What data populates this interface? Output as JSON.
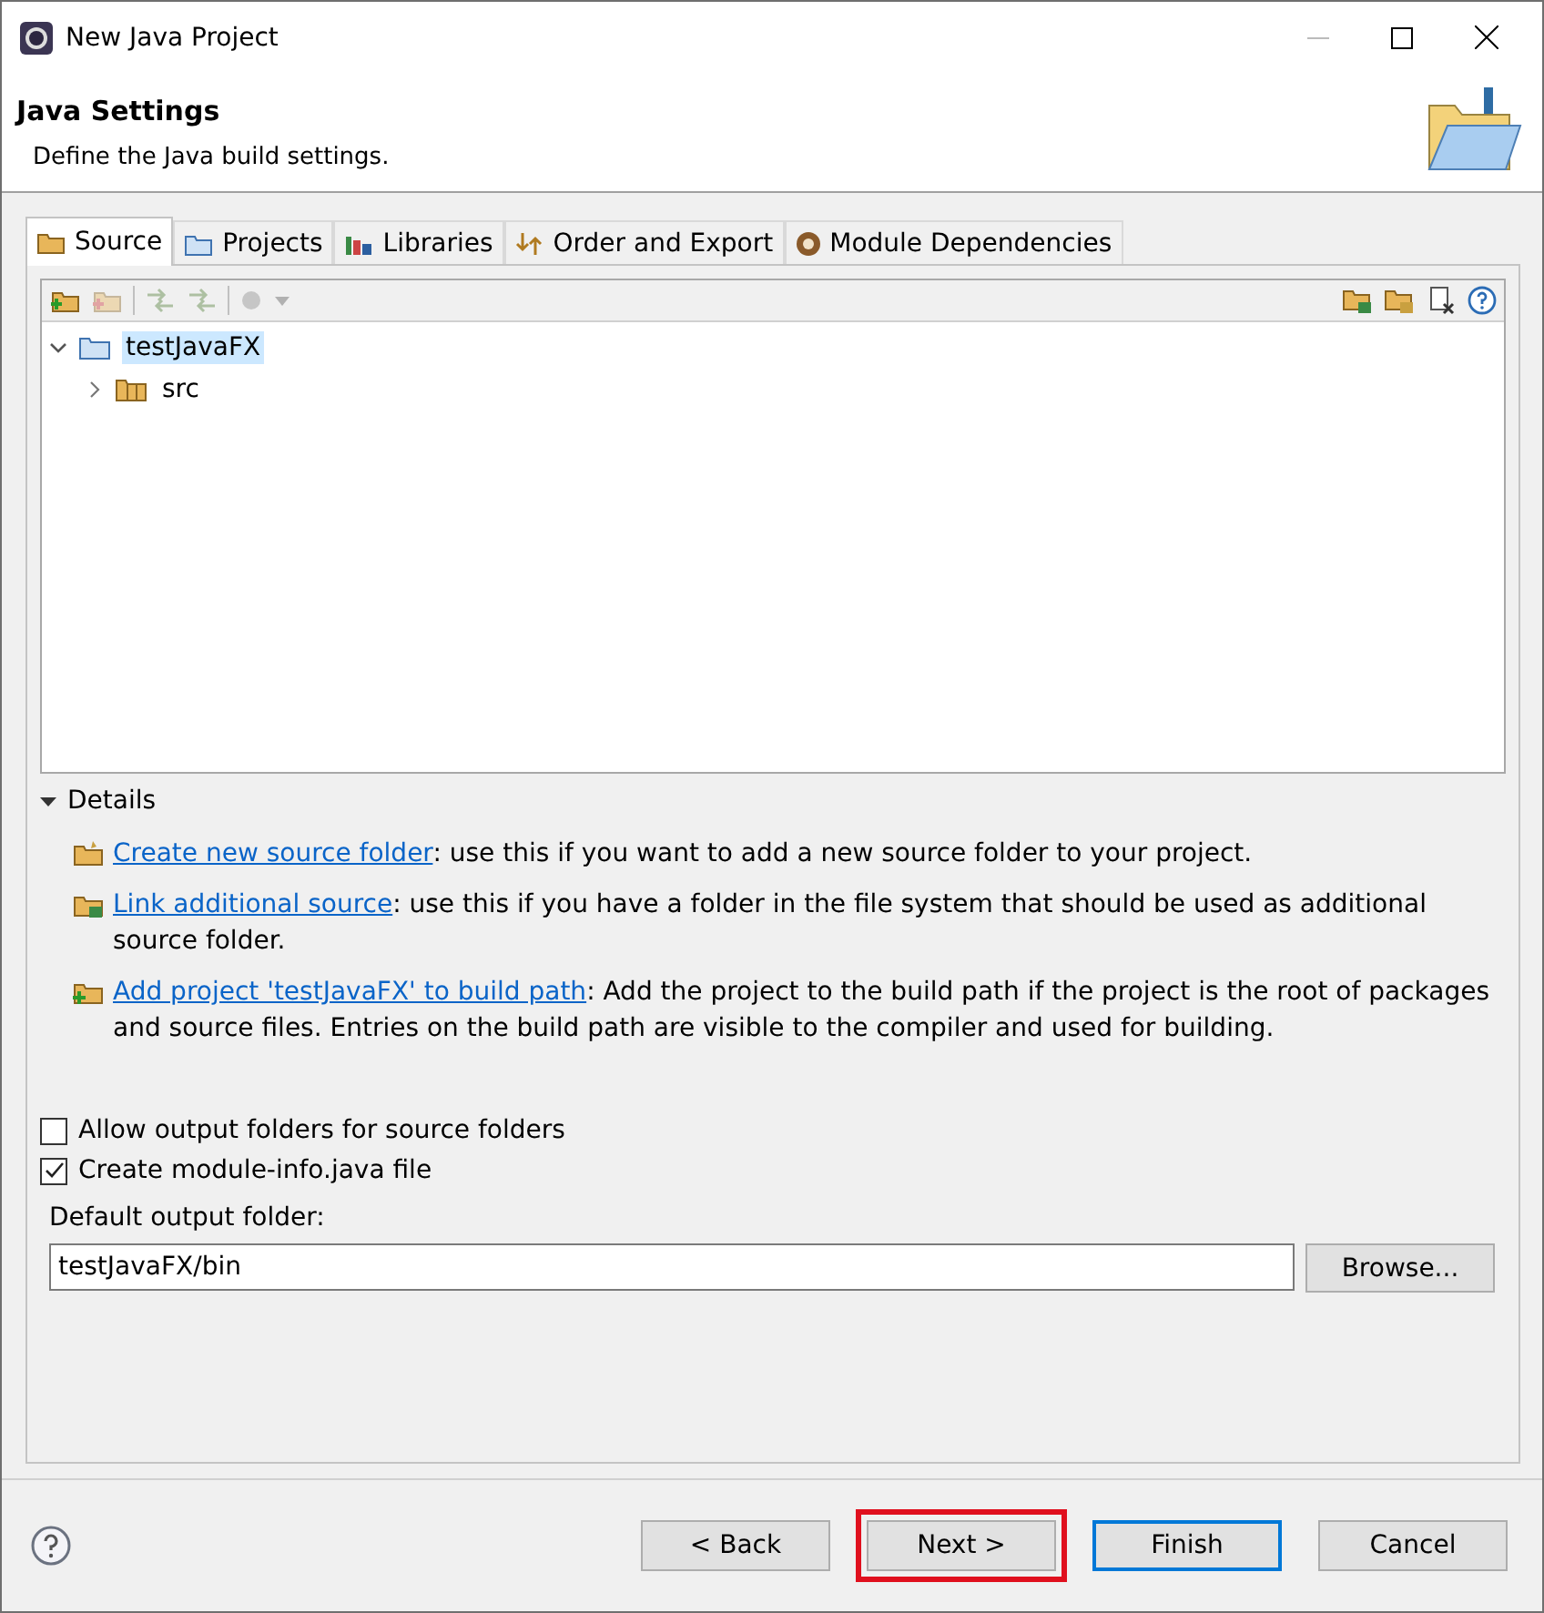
{
  "window": {
    "title": "New Java Project"
  },
  "header": {
    "title": "Java Settings",
    "description": "Define the Java build settings."
  },
  "tabs": [
    {
      "label": "Source",
      "kind": "source",
      "selected": true
    },
    {
      "label": "Projects",
      "kind": "projects",
      "selected": false
    },
    {
      "label": "Libraries",
      "kind": "libraries",
      "selected": false
    },
    {
      "label": "Order and Export",
      "kind": "order",
      "selected": false
    },
    {
      "label": "Module Dependencies",
      "kind": "module",
      "selected": false
    }
  ],
  "toolbar": {
    "left": [
      {
        "kind": "add-folder",
        "disabled": false
      },
      {
        "kind": "remove-folder",
        "disabled": true
      },
      {
        "kind": "sep"
      },
      {
        "kind": "move",
        "disabled": true
      },
      {
        "kind": "move",
        "disabled": true
      },
      {
        "kind": "sep"
      },
      {
        "kind": "menu",
        "disabled": true
      }
    ],
    "right": [
      {
        "kind": "link",
        "disabled": false
      },
      {
        "kind": "new-folder",
        "disabled": false
      },
      {
        "kind": "remove",
        "disabled": false
      },
      {
        "kind": "help",
        "disabled": false
      }
    ]
  },
  "tree": [
    {
      "label": "testJavaFX",
      "kind": "project",
      "expanded": true,
      "selected": true,
      "children": [
        {
          "label": "src",
          "kind": "package",
          "expanded": false,
          "selected": false
        }
      ]
    }
  ],
  "details": {
    "title": "Details",
    "expanded": true,
    "items": [
      {
        "kind": "new-folder",
        "link": "Create new source folder",
        "text": ": use this if you want to add a new source folder to your project."
      },
      {
        "kind": "link",
        "link": "Link additional source",
        "text": ": use this if you have a folder in the file system that should be used as additional source folder."
      },
      {
        "kind": "add-folder",
        "link": "Add project 'testJavaFX' to build path",
        "text": ": Add the project to the build path if the project is the root of packages and source files. Entries on the build path are visible to the compiler and used for building."
      }
    ]
  },
  "options": [
    {
      "label": "Allow output folders for source folders",
      "checked": false
    },
    {
      "label": "Create module-info.java file",
      "checked": true
    }
  ],
  "output": {
    "label": "Default output folder:",
    "value": "testJavaFX/bin",
    "button": "Browse..."
  },
  "buttons": [
    {
      "label": "< Back",
      "default": false,
      "highlighted": false
    },
    {
      "label": "Next >",
      "default": false,
      "highlighted": true
    },
    {
      "label": "Finish",
      "default": true,
      "highlighted": false
    },
    {
      "label": "Cancel",
      "default": false,
      "highlighted": false
    }
  ]
}
